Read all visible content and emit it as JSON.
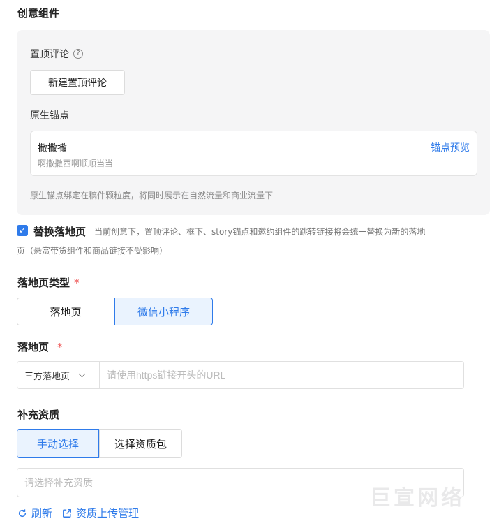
{
  "section_title": "创意组件",
  "pinned_comment": {
    "label": "置顶评论",
    "help_icon": "question-circle-icon",
    "button_label": "新建置顶评论"
  },
  "native_anchor": {
    "label": "原生锚点",
    "card": {
      "name": "撒撒撒",
      "description": "啊撒撒西啊顺顺当当",
      "preview_link": "锚点预览"
    },
    "note": "原生锚点绑定在稿件颗粒度，将同时展示在自然流量和商业流量下"
  },
  "replace_landing": {
    "checked": true,
    "label": "替换落地页",
    "description_line1": "当前创意下，置顶评论、框下、story锚点和邀约组件的跳转链接将会统一替换为新的落地",
    "description_line2": "页（悬赏带货组件和商品链接不受影响）"
  },
  "landing_type": {
    "label": "落地页类型",
    "required_mark": "*",
    "options": [
      "落地页",
      "微信小程序"
    ],
    "selected": "微信小程序"
  },
  "landing_page": {
    "label": "落地页",
    "required_mark": "*",
    "select_value": "三方落地页",
    "input_placeholder": "请使用https链接开头的URL"
  },
  "supplement_qualification": {
    "label": "补充资质",
    "options": [
      "手动选择",
      "选择资质包"
    ],
    "selected": "手动选择",
    "input_placeholder": "请选择补充资质"
  },
  "actions": {
    "refresh_label": "刷新",
    "refresh_icon": "refresh-icon",
    "manage_label": "资质上传管理",
    "manage_icon": "external-link-icon"
  },
  "watermark": "巨宣网络",
  "colors": {
    "accent": "#2f7bea",
    "required": "#e55555",
    "panel_bg": "#f5f5f6"
  }
}
